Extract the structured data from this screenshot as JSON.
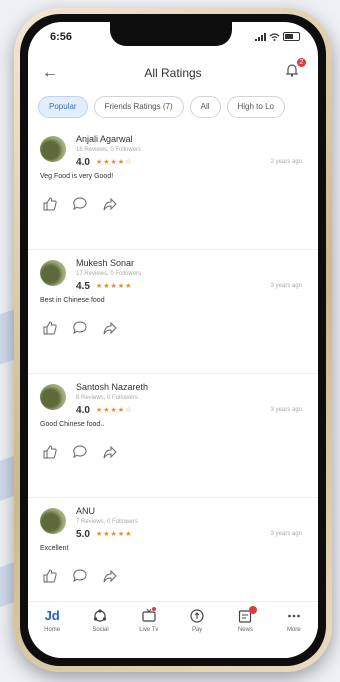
{
  "status_bar": {
    "time": "6:56"
  },
  "header": {
    "title": "All Ratings",
    "notification_count": "2"
  },
  "filters": {
    "chips": [
      "Popular",
      "Friends Ratings (7)",
      "All",
      "High to Lo"
    ]
  },
  "reviews": [
    {
      "name": "Anjali Agarwal",
      "meta": "16 Reviews, 0 Followers",
      "rating": "4.0",
      "stars": "★★★★☆",
      "time": "2 years ago",
      "comment": "Veg Food is very Good!"
    },
    {
      "name": "Mukesh Sonar",
      "meta": "17 Reviews, 0 Followers",
      "rating": "4.5",
      "stars": "★★★★★",
      "time": "3 years ago",
      "comment": "Best in Chinese food"
    },
    {
      "name": "Santosh Nazareth",
      "meta": "8 Reviews, 0 Followers",
      "rating": "4.0",
      "stars": "★★★★☆",
      "time": "3 years ago",
      "comment": "Good Chinese food.."
    },
    {
      "name": "ANU",
      "meta": "7 Reviews, 0 Followers",
      "rating": "5.0",
      "stars": "★★★★★",
      "time": "3 years ago",
      "comment": "Excellent"
    }
  ],
  "bottom_nav": {
    "items": [
      {
        "label": "Home",
        "icon": "jd-logo-icon"
      },
      {
        "label": "Social",
        "icon": "social-icon"
      },
      {
        "label": "Live Tv",
        "icon": "tv-icon"
      },
      {
        "label": "Pay",
        "icon": "pay-icon"
      },
      {
        "label": "News",
        "icon": "news-icon"
      },
      {
        "label": "More",
        "icon": "more-icon"
      }
    ],
    "logo_text": "Jd",
    "news_badge": "34"
  },
  "colors": {
    "accent": "#1f5fd2",
    "star": "#f08a1a",
    "badge": "#e23b3b",
    "chip_active_bg": "#e3edfb"
  }
}
